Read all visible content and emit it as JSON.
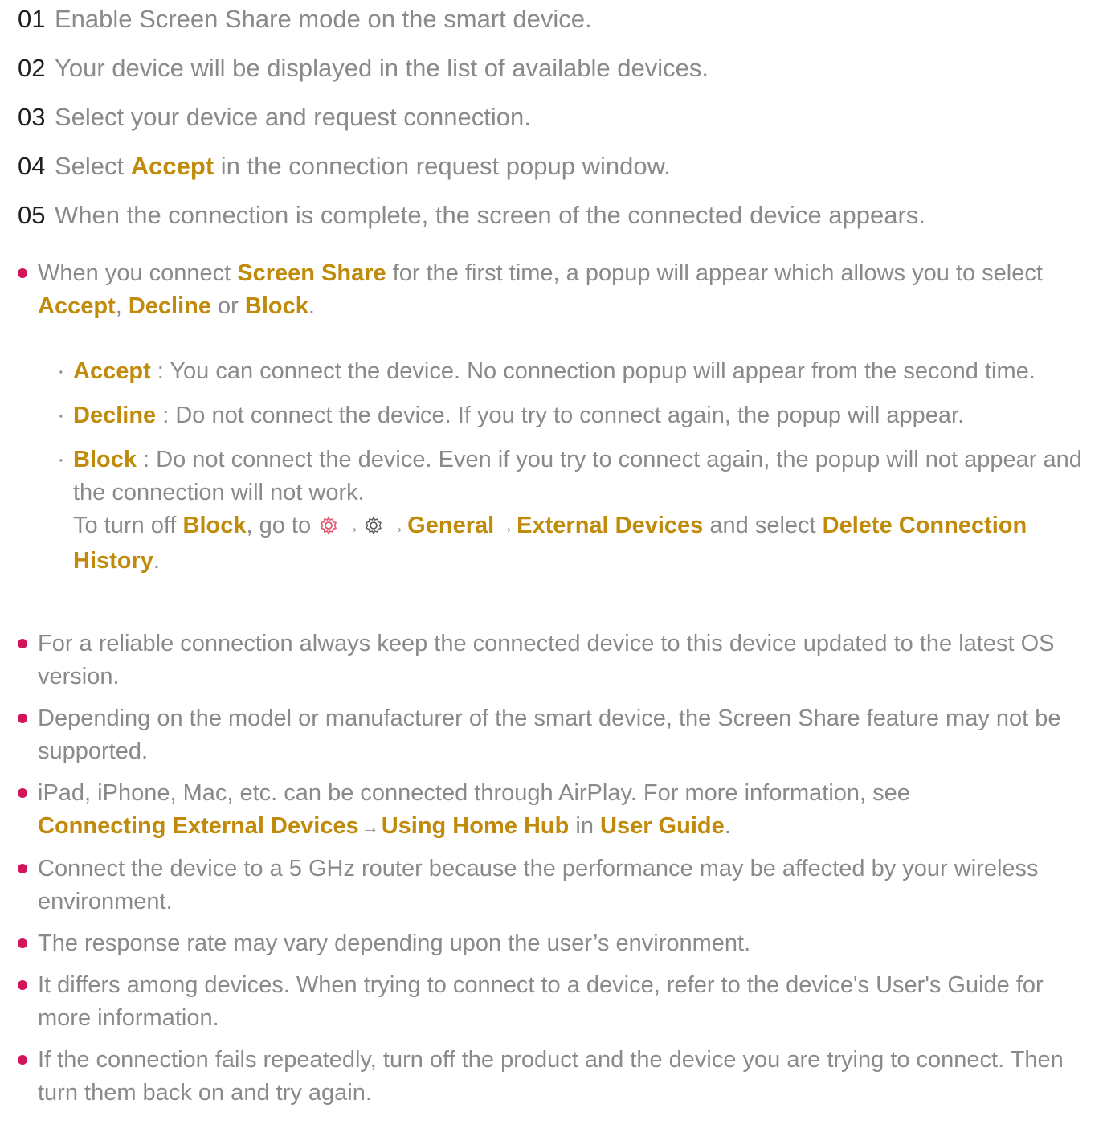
{
  "steps": [
    {
      "num": "01",
      "text": "Enable Screen Share mode on the smart device."
    },
    {
      "num": "02",
      "text": "Your device will be displayed in the list of available devices."
    },
    {
      "num": "03",
      "text": "Select your device and request connection."
    },
    {
      "num": "04",
      "pre": "Select ",
      "hl": "Accept",
      "post": " in the connection request popup window."
    },
    {
      "num": "05",
      "text": "When the connection is complete, the screen of the connected device appears."
    }
  ],
  "note1": {
    "t1": "When you connect ",
    "h1": "Screen Share",
    "t2": " for the first time, a popup will appear which allows you to select ",
    "h2": "Accept",
    "t3": ", ",
    "h3": "Decline",
    "t4": " or ",
    "h4": "Block",
    "t5": "."
  },
  "options": [
    {
      "label": "Accept",
      "text": " : You can connect the device. No connection popup will appear from the second time."
    },
    {
      "label": "Decline",
      "text": " : Do not connect the device. If you try to connect again, the popup will appear."
    },
    {
      "label": "Block",
      "text": " : Do not connect the device. Even if you try to connect again, the popup will not appear and the connection will not work."
    }
  ],
  "block_off": {
    "t1": "To turn off ",
    "h1": "Block",
    "t2": ", go to",
    "h2": "General",
    "h3": "External Devices",
    "t3": " and select ",
    "h4": "Delete Connection History",
    "t4": "."
  },
  "notes": [
    "For a reliable connection always keep the connected device to this device updated to the latest OS version.",
    "Depending on the model or manufacturer of the smart device, the Screen Share feature may not be supported."
  ],
  "note_airplay": {
    "t1": "iPad, iPhone, Mac, etc. can be connected through AirPlay. For more information, see ",
    "h1": "Connecting External Devices",
    "h2": "Using Home Hub",
    "t2": " in ",
    "h3": "User Guide",
    "t3": "."
  },
  "notes2": [
    "Connect the device to a 5 GHz router because the performance may be affected by your wireless environment.",
    "The response rate may vary depending upon the user’s environment.",
    "It differs among devices. When trying to connect to a device, refer to the device's User's Guide for more information.",
    "If the connection fails repeatedly, turn off the product and the device you are trying to connect. Then turn them back on and try again."
  ],
  "colors": {
    "highlight": "#c08a0a",
    "bullet": "#d4145a",
    "text": "#8a8a8a",
    "number": "#1f1f1f",
    "gear_accent": "#e0556e"
  },
  "icons": {
    "arrow": "→",
    "settings_red": "gear-icon-red",
    "settings_gray": "gear-icon-gray"
  }
}
